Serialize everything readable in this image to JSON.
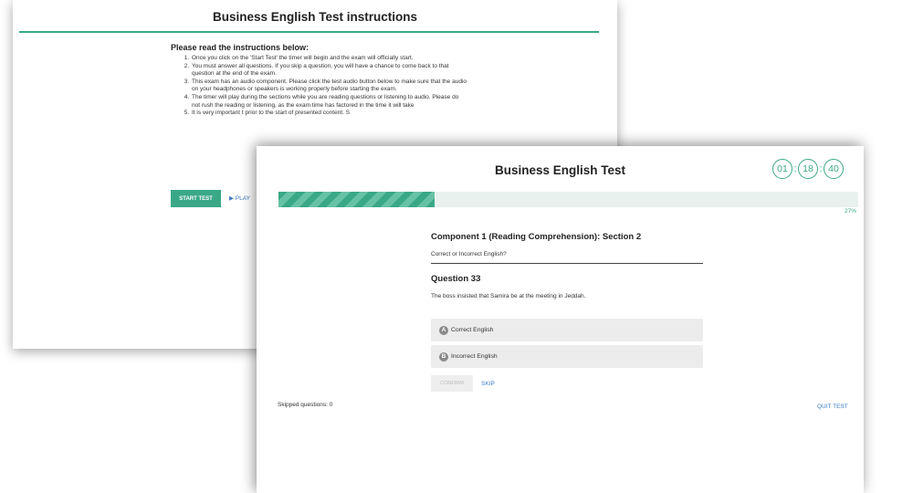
{
  "instructions_window": {
    "title": "Business English Test instructions",
    "subheading": "Please read the instructions below:",
    "items": [
      "Once you click on the 'Start Test' the timer will begin and the exam will officially start.",
      "You must answer all questions. If you skip a question, you will have a chance to come back to that question at the end of the exam.",
      "This exam has an audio component. Please click the test audio button below to make sure that the audio on your headphones or speakers is working properly before starting the exam.",
      "The timer will play during the sections while you are reading questions or listening to audio. Please do not rush the reading or listening, as the exam time has factored in the time it will take",
      "It is very important t prior to the start of presented content. S"
    ],
    "start_button": "START TEST",
    "play_link": "▶ PLAY"
  },
  "test_window": {
    "title": "Business English Test",
    "timer": {
      "hours": "01",
      "minutes": "18",
      "seconds": "40"
    },
    "progress": {
      "percent_value": 0.27,
      "label": "27%"
    },
    "component": "Component 1 (Reading Comprehension): Section 2",
    "subsection": "Correct or Incorrect English?",
    "question_title": "Question 33",
    "question_text": "The boss insisted that Samira be at the meeting in Jeddah.",
    "options": [
      {
        "letter": "A",
        "label": "Correct English"
      },
      {
        "letter": "B",
        "label": "Incorrect English"
      }
    ],
    "confirm_button": "CONFIRM",
    "skip_link": "SKIP",
    "skipped_text": "Skipped questions: 0",
    "quit_link": "QUIT TEST"
  },
  "colors": {
    "accent": "#3aa887",
    "link": "#3b7dc4",
    "option_bg": "#ececec"
  }
}
